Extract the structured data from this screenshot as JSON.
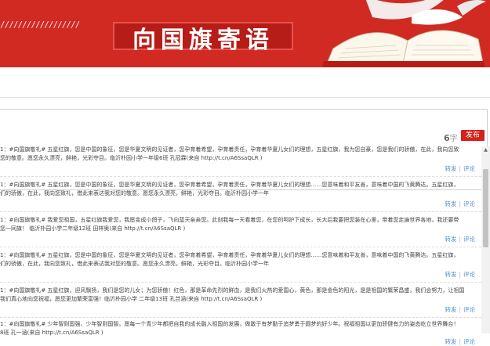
{
  "banner": {
    "hatch": "//////////////////",
    "title": "向国旗寄语"
  },
  "composer": {
    "count_num": "6",
    "count_unit": "字",
    "post_label": "发布"
  },
  "feed": [
    {
      "line1": "1：#向国旗敬礼# 五星红旗，您是中国的象征，您是华夏文明的见证者，您孕育着希望，孕育着责任，孕育着华夏儿女们的理想，五星红旗，我为您自豪，您是我们的骄傲，在此，我向您致",
      "line2": "您的敬意。愿您永久漂亮，鲜艳，光彩夺目。临沂朴园小学一年级6班 孔冠霖(来自 http://t.cn/A6SsaQLR )",
      "share": "转发",
      "comment": "评论"
    },
    {
      "line1": "1：#向国旗敬礼# 五星红旗，您是中国的象征，您是华夏文明的见证者，您孕育着希望，孕育着责任，孕育着华夏儿女们的理想……您意味着和平友善，意味着中国的飞黄腾达。五星红旗，",
      "line2": "们的骄傲，在此，我向您致礼，借此来表达我对您的敬意。愿您永久漂亮，鲜艳，光彩夺目。临沂朴园小学一年",
      "share": "转发",
      "comment": "评论"
    },
    {
      "line1": "1：#向国旗敬礼# 我爱您祖国，五星红旗我爱您，我愿变成小鸽子，飞向蓝天亲亲您。此刻我每一天看着您，在您的呵护下成长，长大后我要把您装在心里，带着您走遍世界各地，我还要带",
      "line2": "您一同旗！ 临沂朴园小学二年级12班 田梓奥(来自 http://t.cn/A6SsaQLR )",
      "share": "转发",
      "comment": "评论"
    },
    {
      "line1": "1：#向国旗敬礼# 五星红旗，您是中国的象征，您是华夏文明的见证者，您孕育着希望，孕育着责任，孕育着华夏儿女们的理想……您意味着和平友善，意味着中国的飞黄腾达。五星红旗，",
      "line2": "们的骄傲，在此，我向您致礼，借此来表达我对您的敬意。愿您永久漂亮，鲜艳，光彩夺目。临沂朴园小学一年",
      "share": "转发",
      "comment": "评论"
    },
    {
      "line1": "1：#向国旗敬礼# 五星红旗，迎风飘扬，我们是您的儿女；为您骄傲！红色，那是革命先烈的鲜血，是我们火热的爱国心，黄色，那是金色的阳光，是是祖国的繁荣昌盛，我们会努力，让祖国",
      "line2": "我们真心地向您祝福，愿您更加繁荣富强！临沂朴园小学 二年级13班 孔芑涵(来自 http://t.cn/A6SsaQLR )",
      "share": "转发",
      "comment": "评论"
    },
    {
      "line1": "1：#向国旗敬礼# 少年智则国强，少年智则国智。愿每一个青少年都把自我的成长融入祖国的发展，做敢于有梦勤于追梦勇于圆梦的好少年。祝福祖国以更加骄健有力的姿态屹立世界舞台！",
      "line2": "8班 孔一涵(来自 http://t.cn/A6SsaQLR )",
      "share": "转发",
      "comment": "评论"
    }
  ]
}
